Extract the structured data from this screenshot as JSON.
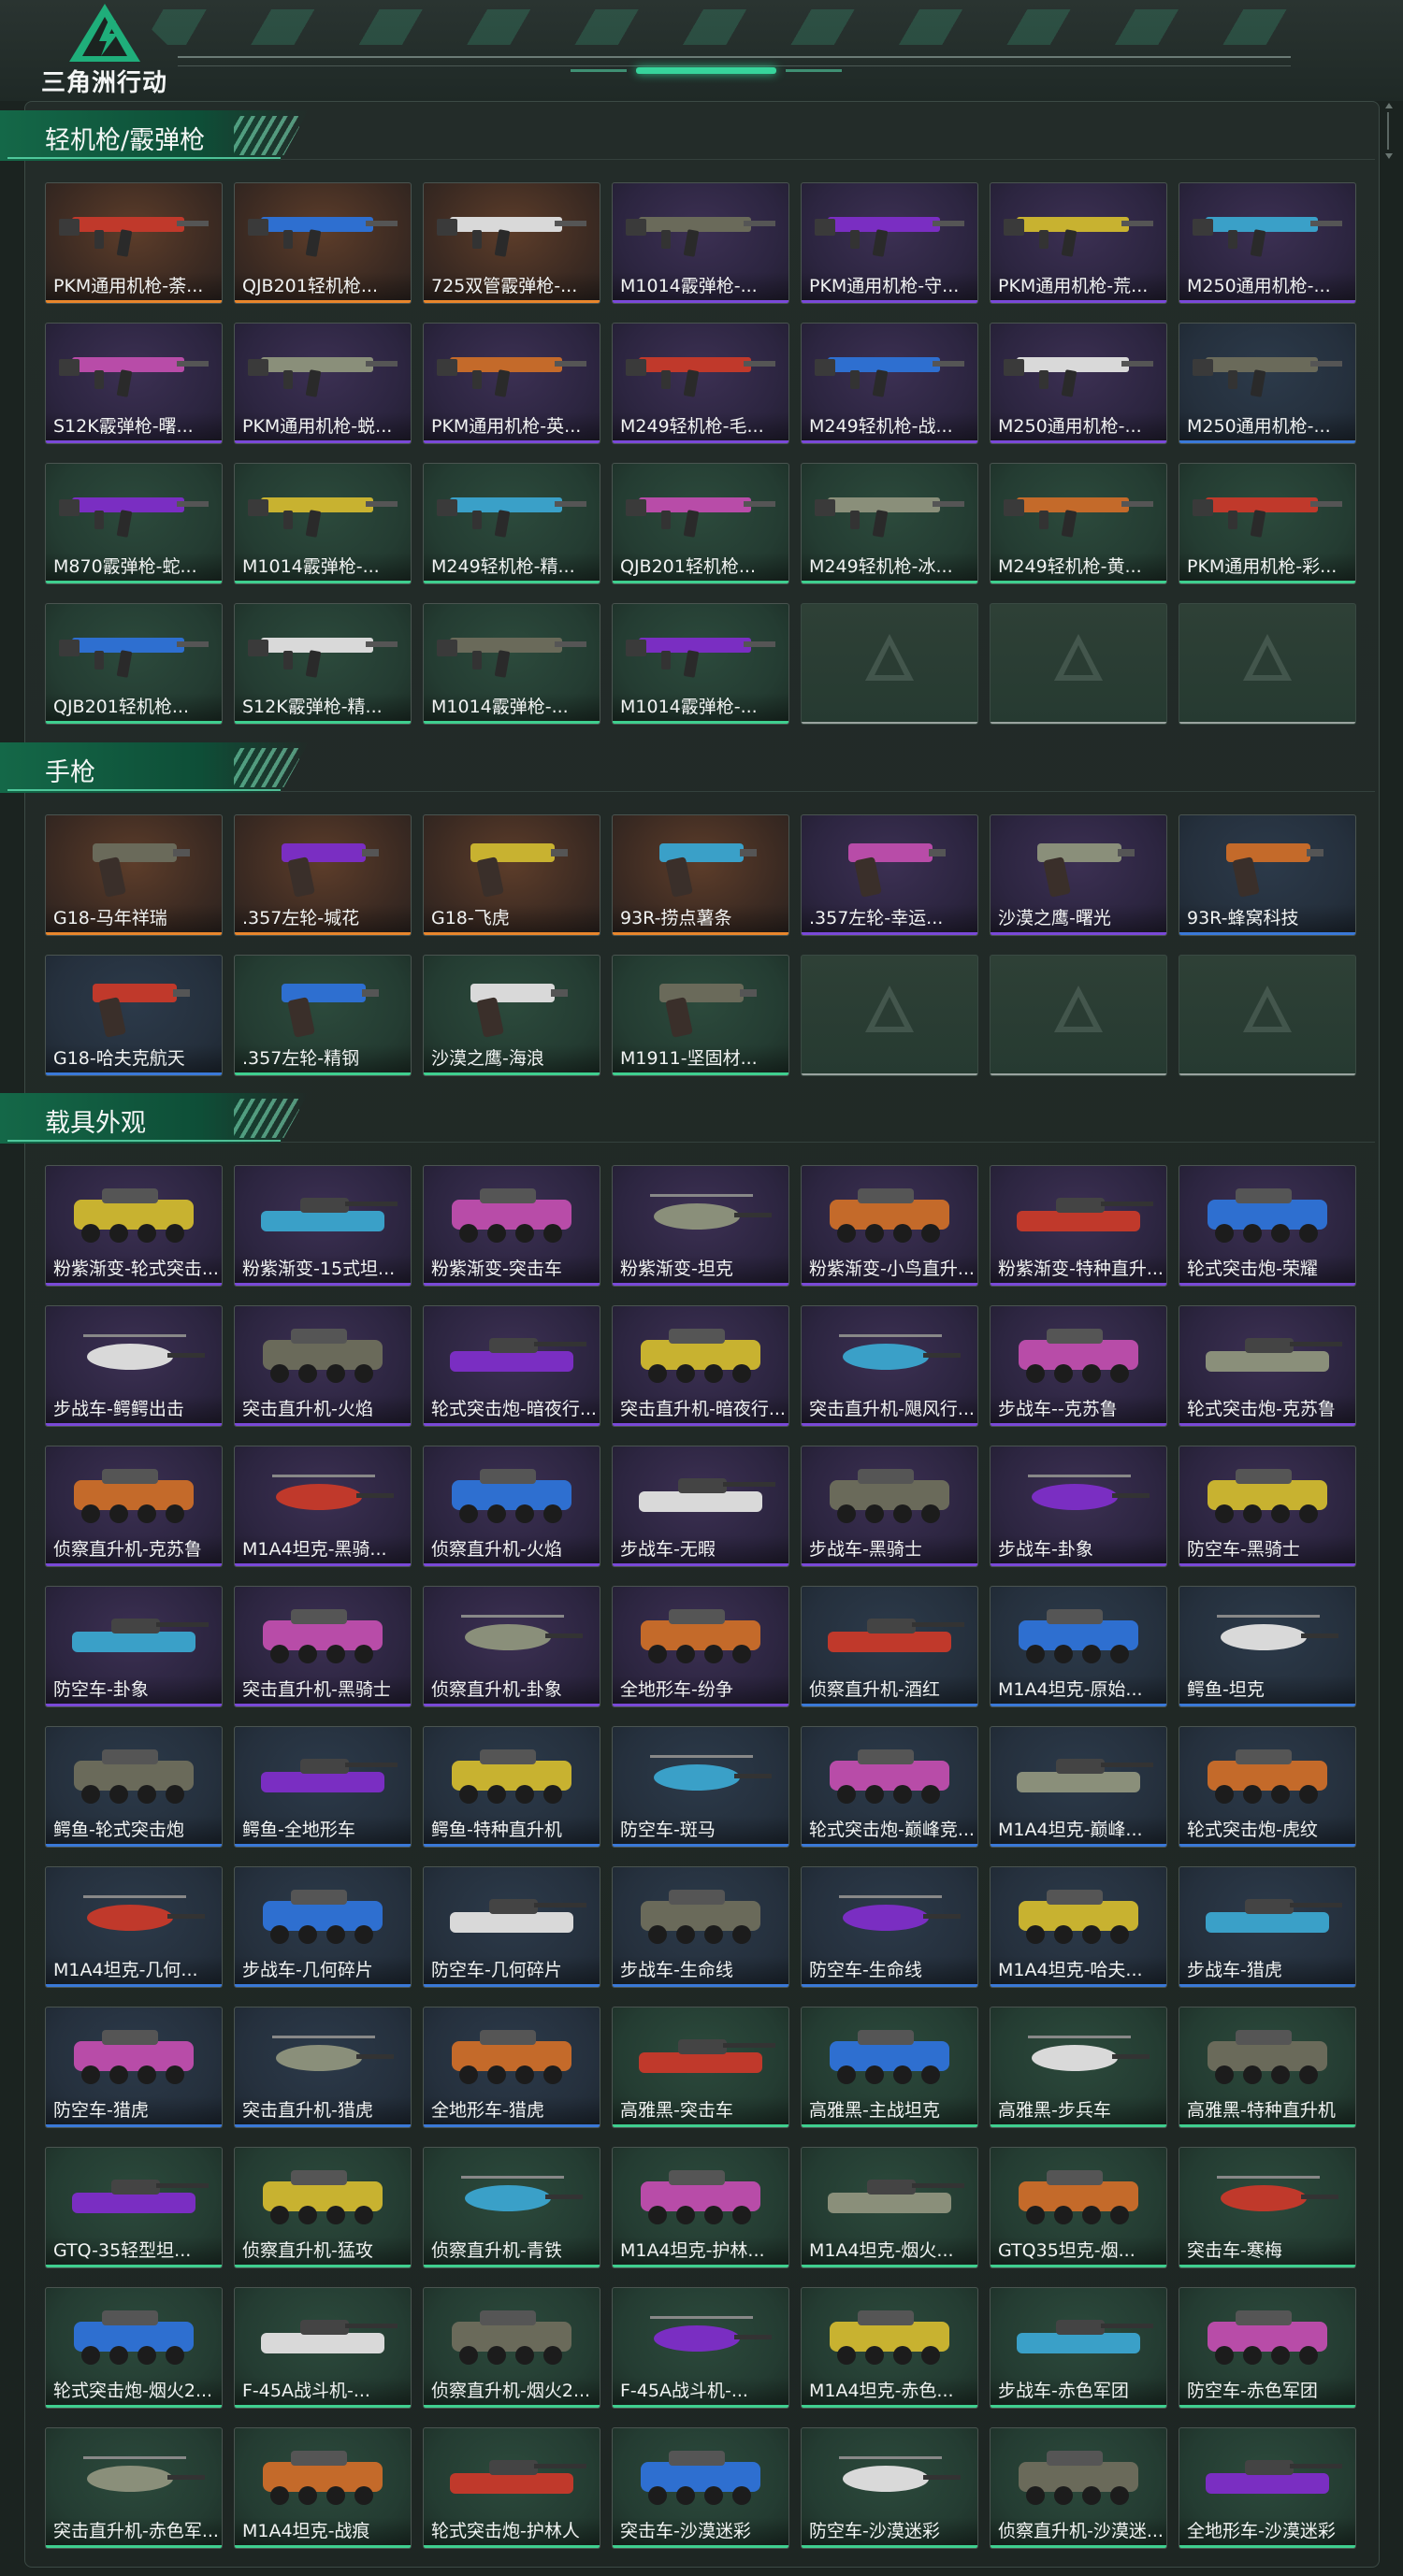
{
  "app": {
    "title": "三角洲行动",
    "accent": "#3fcf8f"
  },
  "rarity_colors": {
    "orange": "#e8862c",
    "purple": "#7a49d8",
    "blue": "#3a79d8",
    "green": "#3fcf8f",
    "grey": "#9aa09e"
  },
  "sections": [
    {
      "title": "轻机枪/霰弹枪",
      "kind": "gun",
      "items": [
        {
          "label": "PKM通用机枪-荼...",
          "rarity": "orange"
        },
        {
          "label": "QJB201轻机枪...",
          "rarity": "orange"
        },
        {
          "label": "725双管霰弹枪-...",
          "rarity": "orange"
        },
        {
          "label": "M1014霰弹枪-...",
          "rarity": "purple"
        },
        {
          "label": "PKM通用机枪-守...",
          "rarity": "purple"
        },
        {
          "label": "PKM通用机枪-荒...",
          "rarity": "purple"
        },
        {
          "label": "M250通用机枪-...",
          "rarity": "purple"
        },
        {
          "label": "S12K霰弹枪-曙...",
          "rarity": "purple"
        },
        {
          "label": "PKM通用机枪-蜕...",
          "rarity": "purple"
        },
        {
          "label": "PKM通用机枪-英...",
          "rarity": "purple"
        },
        {
          "label": "M249轻机枪-毛...",
          "rarity": "purple"
        },
        {
          "label": "M249轻机枪-战...",
          "rarity": "purple"
        },
        {
          "label": "M250通用机枪-...",
          "rarity": "purple"
        },
        {
          "label": "M250通用机枪-...",
          "rarity": "blue"
        },
        {
          "label": "M870霰弹枪-蛇...",
          "rarity": "green"
        },
        {
          "label": "M1014霰弹枪-...",
          "rarity": "green"
        },
        {
          "label": "M249轻机枪-精...",
          "rarity": "green"
        },
        {
          "label": "QJB201轻机枪...",
          "rarity": "green"
        },
        {
          "label": "M249轻机枪-冰...",
          "rarity": "green"
        },
        {
          "label": "M249轻机枪-黄...",
          "rarity": "green"
        },
        {
          "label": "PKM通用机枪-彩...",
          "rarity": "green"
        },
        {
          "label": "QJB201轻机枪...",
          "rarity": "green"
        },
        {
          "label": "S12K霰弹枪-精...",
          "rarity": "green"
        },
        {
          "label": "M1014霰弹枪-...",
          "rarity": "green"
        },
        {
          "label": "M1014霰弹枪-...",
          "rarity": "green"
        },
        {
          "label": "",
          "rarity": "empty"
        },
        {
          "label": "",
          "rarity": "empty"
        },
        {
          "label": "",
          "rarity": "empty"
        }
      ]
    },
    {
      "title": "手枪",
      "kind": "pistol",
      "items": [
        {
          "label": "G18-马年祥瑞",
          "rarity": "orange"
        },
        {
          "label": ".357左轮-堿花",
          "rarity": "orange"
        },
        {
          "label": "G18-飞虎",
          "rarity": "orange"
        },
        {
          "label": "93R-捞点薯条",
          "rarity": "orange"
        },
        {
          "label": ".357左轮-幸运...",
          "rarity": "purple"
        },
        {
          "label": "沙漠之鹰-曙光",
          "rarity": "purple"
        },
        {
          "label": "93R-蜂窝科技",
          "rarity": "blue"
        },
        {
          "label": "G18-哈夫克航天",
          "rarity": "blue"
        },
        {
          "label": ".357左轮-精钢",
          "rarity": "green"
        },
        {
          "label": "沙漠之鹰-海浪",
          "rarity": "green"
        },
        {
          "label": "M1911-坚固材...",
          "rarity": "green"
        },
        {
          "label": "",
          "rarity": "empty"
        },
        {
          "label": "",
          "rarity": "empty"
        },
        {
          "label": "",
          "rarity": "empty"
        }
      ]
    },
    {
      "title": "载具外观",
      "kind": "vehicle",
      "items": [
        {
          "label": "粉紫渐变-轮式突击...",
          "rarity": "purple"
        },
        {
          "label": "粉紫渐变-15式坦...",
          "rarity": "purple"
        },
        {
          "label": "粉紫渐变-突击车",
          "rarity": "purple"
        },
        {
          "label": "粉紫渐变-坦克",
          "rarity": "purple"
        },
        {
          "label": "粉紫渐变-小鸟直升...",
          "rarity": "purple"
        },
        {
          "label": "粉紫渐变-特种直升...",
          "rarity": "purple"
        },
        {
          "label": "轮式突击炮-荣耀",
          "rarity": "purple"
        },
        {
          "label": "步战车-鳄鳄出击",
          "rarity": "purple"
        },
        {
          "label": "突击直升机-火焰",
          "rarity": "purple"
        },
        {
          "label": "轮式突击炮-暗夜行...",
          "rarity": "purple"
        },
        {
          "label": "突击直升机-暗夜行...",
          "rarity": "purple"
        },
        {
          "label": "突击直升机-飓风行...",
          "rarity": "purple"
        },
        {
          "label": "步战车--克苏鲁",
          "rarity": "purple"
        },
        {
          "label": "轮式突击炮-克苏鲁",
          "rarity": "purple"
        },
        {
          "label": "侦察直升机-克苏鲁",
          "rarity": "purple"
        },
        {
          "label": "M1A4坦克-黑骑...",
          "rarity": "purple"
        },
        {
          "label": "侦察直升机-火焰",
          "rarity": "purple"
        },
        {
          "label": "步战车-无暇",
          "rarity": "purple"
        },
        {
          "label": "步战车-黑骑士",
          "rarity": "purple"
        },
        {
          "label": "步战车-卦象",
          "rarity": "purple"
        },
        {
          "label": "防空车-黑骑士",
          "rarity": "purple"
        },
        {
          "label": "防空车-卦象",
          "rarity": "purple"
        },
        {
          "label": "突击直升机-黑骑士",
          "rarity": "purple"
        },
        {
          "label": "侦察直升机-卦象",
          "rarity": "purple"
        },
        {
          "label": "全地形车-纷争",
          "rarity": "purple"
        },
        {
          "label": "侦察直升机-酒红",
          "rarity": "blue"
        },
        {
          "label": "M1A4坦克-原始...",
          "rarity": "blue"
        },
        {
          "label": "鳄鱼-坦克",
          "rarity": "blue"
        },
        {
          "label": "鳄鱼-轮式突击炮",
          "rarity": "blue"
        },
        {
          "label": "鳄鱼-全地形车",
          "rarity": "blue"
        },
        {
          "label": "鳄鱼-特种直升机",
          "rarity": "blue"
        },
        {
          "label": "防空车-斑马",
          "rarity": "blue"
        },
        {
          "label": "轮式突击炮-巅峰竞...",
          "rarity": "blue"
        },
        {
          "label": "M1A4坦克-巅峰...",
          "rarity": "blue"
        },
        {
          "label": "轮式突击炮-虎纹",
          "rarity": "blue"
        },
        {
          "label": "M1A4坦克-几何...",
          "rarity": "blue"
        },
        {
          "label": "步战车-几何碎片",
          "rarity": "blue"
        },
        {
          "label": "防空车-几何碎片",
          "rarity": "blue"
        },
        {
          "label": "步战车-生命线",
          "rarity": "blue"
        },
        {
          "label": "防空车-生命线",
          "rarity": "blue"
        },
        {
          "label": "M1A4坦克-哈夫...",
          "rarity": "blue"
        },
        {
          "label": "步战车-猎虎",
          "rarity": "blue"
        },
        {
          "label": "防空车-猎虎",
          "rarity": "blue"
        },
        {
          "label": "突击直升机-猎虎",
          "rarity": "blue"
        },
        {
          "label": "全地形车-猎虎",
          "rarity": "blue"
        },
        {
          "label": "高雅黑-突击车",
          "rarity": "green"
        },
        {
          "label": "高雅黑-主战坦克",
          "rarity": "green"
        },
        {
          "label": "高雅黑-步兵车",
          "rarity": "green"
        },
        {
          "label": "高雅黑-特种直升机",
          "rarity": "green"
        },
        {
          "label": "GTQ-35轻型坦...",
          "rarity": "green"
        },
        {
          "label": "侦察直升机-猛攻",
          "rarity": "green"
        },
        {
          "label": "侦察直升机-青铁",
          "rarity": "green"
        },
        {
          "label": "M1A4坦克-护林...",
          "rarity": "green"
        },
        {
          "label": "M1A4坦克-烟火...",
          "rarity": "green"
        },
        {
          "label": "GTQ35坦克-烟...",
          "rarity": "green"
        },
        {
          "label": "突击车-寒梅",
          "rarity": "green"
        },
        {
          "label": "轮式突击炮-烟火2...",
          "rarity": "green"
        },
        {
          "label": "F-45A战斗机-...",
          "rarity": "green"
        },
        {
          "label": "侦察直升机-烟火2...",
          "rarity": "green"
        },
        {
          "label": "F-45A战斗机-...",
          "rarity": "green"
        },
        {
          "label": "M1A4坦克-赤色...",
          "rarity": "green"
        },
        {
          "label": "步战车-赤色军团",
          "rarity": "green"
        },
        {
          "label": "防空车-赤色军团",
          "rarity": "green"
        },
        {
          "label": "突击直升机-赤色军...",
          "rarity": "green"
        },
        {
          "label": "M1A4坦克-战痕",
          "rarity": "green"
        },
        {
          "label": "轮式突击炮-护林人",
          "rarity": "green"
        },
        {
          "label": "突击车-沙漠迷彩",
          "rarity": "green"
        },
        {
          "label": "防空车-沙漠迷彩",
          "rarity": "green"
        },
        {
          "label": "侦察直升机-沙漠迷...",
          "rarity": "green"
        },
        {
          "label": "全地形车-沙漠迷彩",
          "rarity": "green"
        }
      ]
    }
  ]
}
